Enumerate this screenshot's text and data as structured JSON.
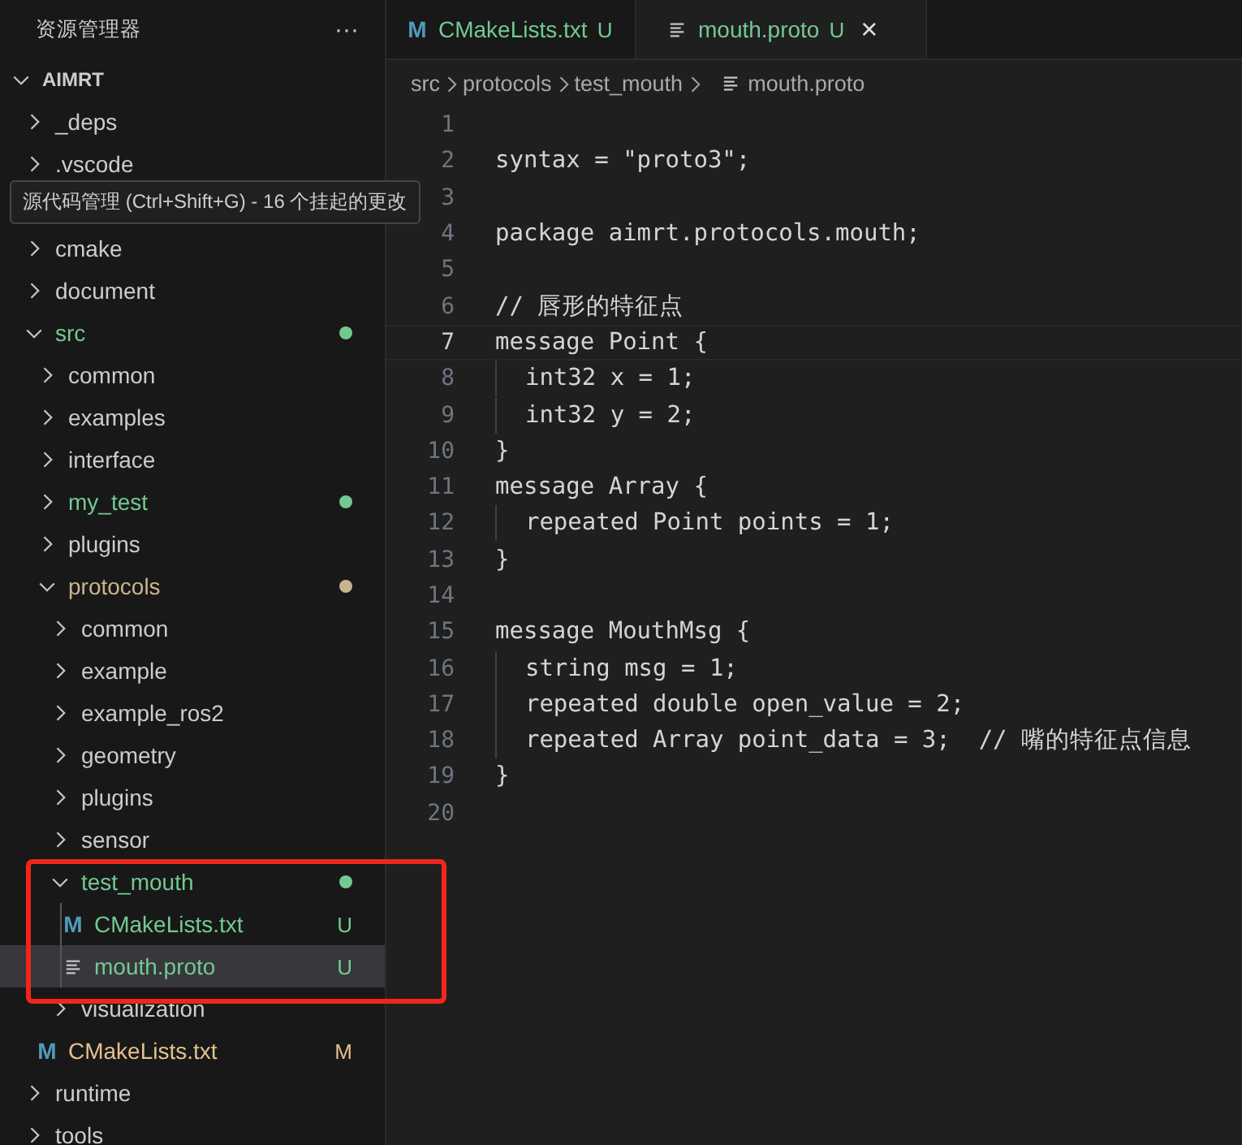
{
  "explorer": {
    "title": "资源管理器",
    "more": "···",
    "tree": [
      {
        "name": "AIMRT",
        "kind": "root",
        "expanded": true,
        "selected": false,
        "children": [
          {
            "name": "_deps",
            "kind": "folder",
            "expanded": false,
            "selected": false
          },
          {
            "name": ".vscode",
            "kind": "folder",
            "expanded": false,
            "selected": false
          },
          {
            "kind": "tooltip",
            "text": "源代码管理 (Ctrl+Shift+G) - 16 个挂起的更改"
          },
          {
            "name": "cmake",
            "kind": "folder",
            "expanded": false,
            "selected": false
          },
          {
            "name": "document",
            "kind": "folder",
            "expanded": false,
            "selected": false
          },
          {
            "name": "src",
            "kind": "folder",
            "expanded": true,
            "selected": false,
            "color": "#73c991",
            "dot": true,
            "children": [
              {
                "name": "common",
                "kind": "folder",
                "expanded": false,
                "selected": false
              },
              {
                "name": "examples",
                "kind": "folder",
                "expanded": false,
                "selected": false
              },
              {
                "name": "interface",
                "kind": "folder",
                "expanded": false,
                "selected": false
              },
              {
                "name": "my_test",
                "kind": "folder",
                "expanded": false,
                "selected": false,
                "color": "#73c991",
                "dot": true
              },
              {
                "name": "plugins",
                "kind": "folder",
                "expanded": false,
                "selected": false
              },
              {
                "name": "protocols",
                "kind": "folder",
                "expanded": true,
                "selected": false,
                "color": "#c9b48d",
                "dot": true,
                "children": [
                  {
                    "name": "common",
                    "kind": "folder",
                    "expanded": false,
                    "selected": false
                  },
                  {
                    "name": "example",
                    "kind": "folder",
                    "expanded": false,
                    "selected": false
                  },
                  {
                    "name": "example_ros2",
                    "kind": "folder",
                    "expanded": false,
                    "selected": false
                  },
                  {
                    "name": "geometry",
                    "kind": "folder",
                    "expanded": false,
                    "selected": false
                  },
                  {
                    "name": "plugins",
                    "kind": "folder",
                    "expanded": false,
                    "selected": false
                  },
                  {
                    "name": "sensor",
                    "kind": "folder",
                    "expanded": false,
                    "selected": false
                  },
                  {
                    "name": "test_mouth",
                    "kind": "folder",
                    "expanded": true,
                    "selected": false,
                    "color": "#73c991",
                    "dot": true,
                    "children": [
                      {
                        "name": "CMakeLists.txt",
                        "kind": "cmake",
                        "icon": "M",
                        "selected": false,
                        "color": "#73c991",
                        "badge": "U"
                      },
                      {
                        "name": "mouth.proto",
                        "kind": "text",
                        "selected": true,
                        "color": "#73c991",
                        "badge": "U"
                      }
                    ]
                  },
                  {
                    "name": "visualization",
                    "kind": "folder",
                    "expanded": false,
                    "selected": false
                  }
                ]
              },
              {
                "name": "CMakeLists.txt",
                "kind": "cmake",
                "icon": "M",
                "selected": false,
                "color": "#e2c08d",
                "badge": "M"
              }
            ]
          },
          {
            "name": "runtime",
            "kind": "folder",
            "expanded": false,
            "selected": false
          },
          {
            "name": "tools",
            "kind": "folder",
            "expanded": false,
            "selected": false
          }
        ]
      }
    ]
  },
  "tabs": [
    {
      "label": "CMakeLists.txt",
      "kind": "cmake",
      "icon": "M",
      "badge": "U",
      "selected": false
    },
    {
      "label": "mouth.proto",
      "kind": "text",
      "badge": "U",
      "close": "×",
      "selected": true
    }
  ],
  "breadcrumbs": [
    "src",
    "protocols",
    "test_mouth",
    "mouth.proto"
  ],
  "code": [
    {
      "n": "1",
      "current": false
    },
    {
      "n": "2",
      "text": "syntax = \"proto3\";",
      "current": false
    },
    {
      "n": "3",
      "current": false
    },
    {
      "n": "4",
      "text": "package aimrt.protocols.mouth;",
      "current": false
    },
    {
      "n": "5",
      "current": false
    },
    {
      "n": "6",
      "text": "// 唇形的特征点",
      "current": false
    },
    {
      "n": "7",
      "text": "message Point {",
      "current": true
    },
    {
      "n": "8",
      "text": "  int32 x = 1;",
      "current": false
    },
    {
      "n": "9",
      "text": "  int32 y = 2;",
      "current": false
    },
    {
      "n": "10",
      "text": "}",
      "current": false
    },
    {
      "n": "11",
      "text": "message Array {",
      "current": false
    },
    {
      "n": "12",
      "text": "  repeated Point points = 1;",
      "current": false
    },
    {
      "n": "13",
      "text": "}",
      "current": false
    },
    {
      "n": "14",
      "current": false
    },
    {
      "n": "15",
      "text": "message MouthMsg {",
      "current": false
    },
    {
      "n": "16",
      "text": "  string msg = 1;",
      "current": false
    },
    {
      "n": "17",
      "text": "  repeated double open_value = 2;",
      "current": false
    },
    {
      "n": "18",
      "text": "  repeated Array point_data = 3;  // 嘴的特征点信息",
      "current": false
    },
    {
      "n": "19",
      "text": "}",
      "current": false
    },
    {
      "n": "20",
      "current": false
    }
  ]
}
